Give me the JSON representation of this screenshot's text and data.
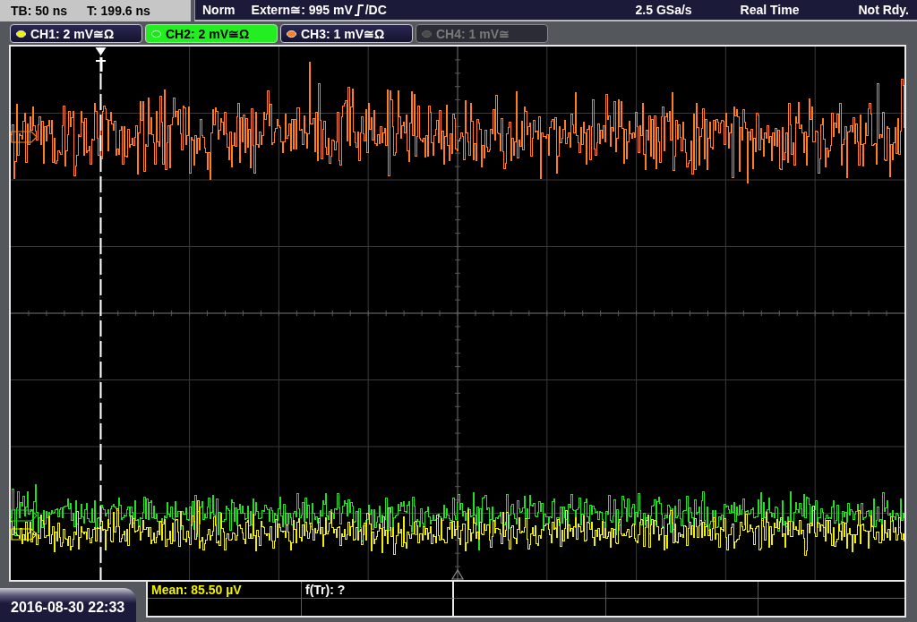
{
  "timebase": {
    "tb": "TB: 50 ns",
    "t": "T: 199.6 ns"
  },
  "trigger": {
    "mode": "Norm",
    "source": "Extern≅: 995 mV",
    "coupling": "/DC"
  },
  "acquisition": {
    "sample_rate": "2.5 GSa/s",
    "mode": "Real Time",
    "status": "Not Rdy."
  },
  "channels": [
    {
      "label": "CH1: 2 mV≅Ω",
      "color": "#f0f000",
      "selected": false,
      "disabled": false
    },
    {
      "label": "CH2: 2 mV≅Ω",
      "color": "#20e020",
      "selected": true,
      "disabled": false
    },
    {
      "label": "CH3: 1 mV≅Ω",
      "color": "#ff7f20",
      "selected": false,
      "disabled": false
    },
    {
      "label": "CH4: 1 mV≅",
      "color": "#4a4a4a",
      "selected": false,
      "disabled": true
    }
  ],
  "datetime": "2016-08-30 22:33",
  "measurements": [
    {
      "text": "Mean: 85.50 µV",
      "kind": "channel"
    },
    {
      "text": "f(Tr): ?",
      "kind": "trigger"
    }
  ]
}
